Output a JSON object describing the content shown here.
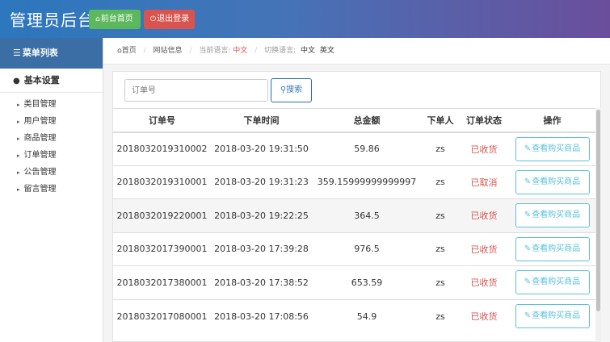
{
  "header": {
    "title": "管理员后台",
    "home_label": "前台首页",
    "logout_label": "退出登录"
  },
  "sidebar": {
    "menu_title": "菜单列表",
    "group_title": "基本设置",
    "items": [
      {
        "label": "类目管理"
      },
      {
        "label": "用户管理"
      },
      {
        "label": "商品管理"
      },
      {
        "label": "订单管理"
      },
      {
        "label": "公告管理"
      },
      {
        "label": "留言管理"
      }
    ]
  },
  "breadcrumb": {
    "home": "首页",
    "site_info": "网站信息",
    "current_lang_label": "当前语言:",
    "current_lang": "中文",
    "switch_lang_label": "切换语言:",
    "lang_zh": "中文",
    "lang_en": "英文"
  },
  "search": {
    "placeholder": "订单号",
    "button_label": "搜索"
  },
  "table": {
    "headers": [
      "订单号",
      "下单时间",
      "总金额",
      "下单人",
      "订单状态",
      "操作"
    ],
    "rows": [
      {
        "order_no": "2018032019310002",
        "time": "2018-03-20 19:31:50",
        "amount": "59.86",
        "user": "zs",
        "status": "已收货",
        "action": "查看购买商品"
      },
      {
        "order_no": "2018032019310001",
        "time": "2018-03-20 19:31:23",
        "amount": "359.15999999999997",
        "user": "zs",
        "status": "已取消",
        "action": "查看购买商品"
      },
      {
        "order_no": "2018032019220001",
        "time": "2018-03-20 19:22:25",
        "amount": "364.5",
        "user": "zs",
        "status": "已收货",
        "action": "查看购买商品"
      },
      {
        "order_no": "2018032017390001",
        "time": "2018-03-20 17:39:28",
        "amount": "976.5",
        "user": "zs",
        "status": "已收货",
        "action": "查看购买商品"
      },
      {
        "order_no": "2018032017380001",
        "time": "2018-03-20 17:38:52",
        "amount": "653.59",
        "user": "zs",
        "status": "已收货",
        "action": "查看购买商品"
      },
      {
        "order_no": "2018032017080001",
        "time": "2018-03-20 17:08:56",
        "amount": "54.9",
        "user": "zs",
        "status": "已收货",
        "action": "查看购买商品"
      }
    ]
  },
  "colors": {
    "status_red": "#d9534f",
    "info_blue": "#5bc0de",
    "home_green": "#5cb85c",
    "logout_red": "#d9534f"
  }
}
